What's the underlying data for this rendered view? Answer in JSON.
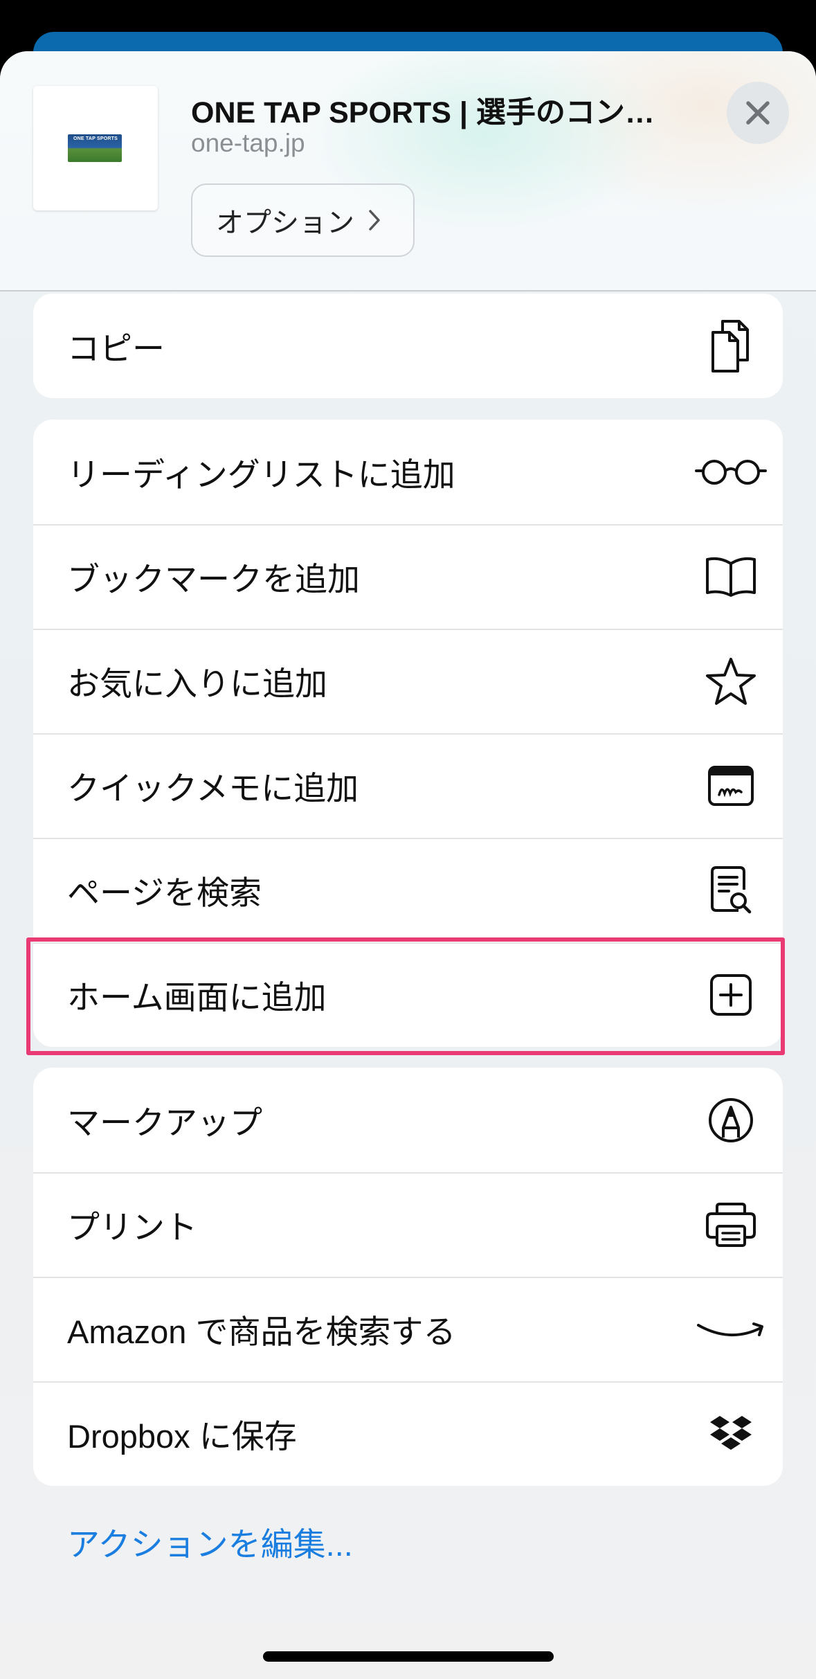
{
  "header": {
    "title": "ONE TAP SPORTS | 選手のコン…",
    "domain": "one-tap.jp",
    "thumbnail_text": "ONE TAP SPORTS",
    "options_label": "オプション",
    "close_icon": "close-icon"
  },
  "copy_card": {
    "items": [
      {
        "label": "コピー",
        "icon": "copy-icon"
      }
    ]
  },
  "actions_card": {
    "items": [
      {
        "label": "リーディングリストに追加",
        "icon": "glasses-icon"
      },
      {
        "label": "ブックマークを追加",
        "icon": "book-icon"
      },
      {
        "label": "お気に入りに追加",
        "icon": "star-icon"
      },
      {
        "label": "クイックメモに追加",
        "icon": "quick-note-icon"
      },
      {
        "label": "ページを検索",
        "icon": "find-in-page-icon"
      },
      {
        "label": "ホーム画面に追加",
        "icon": "add-square-icon",
        "highlighted": true
      }
    ]
  },
  "extensions_card": {
    "items": [
      {
        "label": "マークアップ",
        "icon": "markup-pen-icon"
      },
      {
        "label": "プリント",
        "icon": "printer-icon"
      },
      {
        "label": "Amazon で商品を検索する",
        "icon": "amazon-smile-icon"
      },
      {
        "label": "Dropbox に保存",
        "icon": "dropbox-icon"
      }
    ]
  },
  "edit_actions_label": "アクションを編集...",
  "colors": {
    "accent_link": "#1a7ee0",
    "highlight_border": "#e93a73",
    "behind_card": "#0a6aad"
  }
}
